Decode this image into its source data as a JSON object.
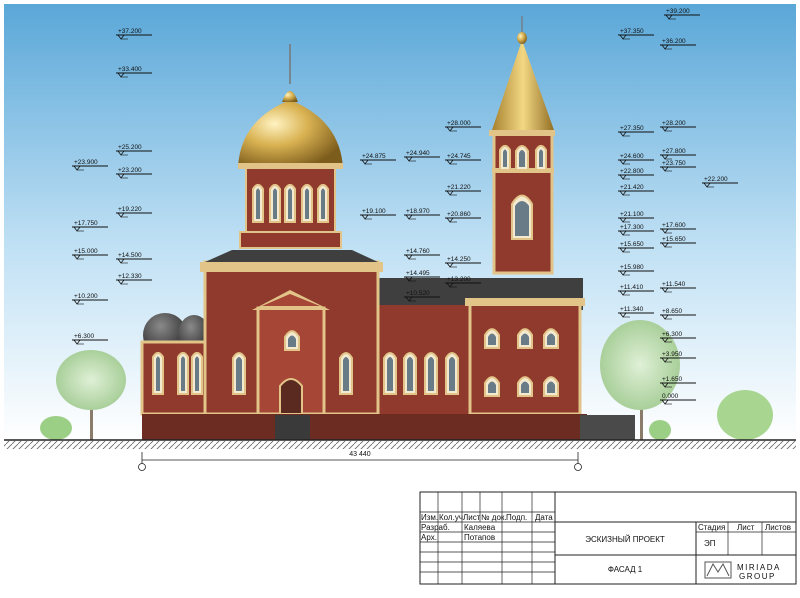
{
  "drawing": {
    "elevation_marks": [
      {
        "label": "+39.200",
        "side": "right"
      },
      {
        "label": "+37.200",
        "side": "left"
      },
      {
        "label": "+37.350",
        "side": "right"
      },
      {
        "label": "+36.200",
        "side": "right"
      },
      {
        "label": "+33.400",
        "side": "left"
      },
      {
        "label": "+28.000",
        "side": "mid"
      },
      {
        "label": "+27.350",
        "side": "right"
      },
      {
        "label": "+28.200",
        "side": "right"
      },
      {
        "label": "+27.800",
        "side": "right"
      },
      {
        "label": "+25.200",
        "side": "left"
      },
      {
        "label": "+24.875",
        "side": "mid"
      },
      {
        "label": "+24.940",
        "side": "mid"
      },
      {
        "label": "+24.745",
        "side": "mid"
      },
      {
        "label": "+24.600",
        "side": "right"
      },
      {
        "label": "+23.750",
        "side": "right"
      },
      {
        "label": "+23.900",
        "side": "left"
      },
      {
        "label": "+23.200",
        "side": "left"
      },
      {
        "label": "+22.800",
        "side": "right"
      },
      {
        "label": "+22.200",
        "side": "right"
      },
      {
        "label": "+21.420",
        "side": "right"
      },
      {
        "label": "+21.220",
        "side": "mid"
      },
      {
        "label": "+20.860",
        "side": "mid"
      },
      {
        "label": "+21.100",
        "side": "right"
      },
      {
        "label": "+19.220",
        "side": "left"
      },
      {
        "label": "+19.100",
        "side": "mid"
      },
      {
        "label": "+18.970",
        "side": "mid"
      },
      {
        "label": "+17.750",
        "side": "left"
      },
      {
        "label": "+17.300",
        "side": "right"
      },
      {
        "label": "+17.600",
        "side": "right"
      },
      {
        "label": "+15.650",
        "side": "right"
      },
      {
        "label": "+15.650",
        "side": "right"
      },
      {
        "label": "+15.000",
        "side": "left"
      },
      {
        "label": "+14.760",
        "side": "mid"
      },
      {
        "label": "+14.500",
        "side": "left"
      },
      {
        "label": "+14.250",
        "side": "mid"
      },
      {
        "label": "+14.495",
        "side": "mid"
      },
      {
        "label": "+15.980",
        "side": "right"
      },
      {
        "label": "+12.330",
        "side": "left"
      },
      {
        "label": "+13.200",
        "side": "mid"
      },
      {
        "label": "+11.410",
        "side": "right"
      },
      {
        "label": "+11.540",
        "side": "right"
      },
      {
        "label": "+10.200",
        "side": "left"
      },
      {
        "label": "+10.520",
        "side": "mid"
      },
      {
        "label": "+11.340",
        "side": "right"
      },
      {
        "label": "+8.650",
        "side": "right"
      },
      {
        "label": "+6.300",
        "side": "left"
      },
      {
        "label": "+6.300",
        "side": "right"
      },
      {
        "label": "+3.950",
        "side": "right"
      },
      {
        "label": "+1.650",
        "side": "right"
      },
      {
        "label": "0.000",
        "side": "right"
      }
    ],
    "overall_dimension": "43 440"
  },
  "title_block": {
    "headers": [
      "Изм.",
      "Кол.уч",
      "Лист",
      "№ док.",
      "Подп.",
      "Дата"
    ],
    "rows": [
      {
        "role": "Разраб.",
        "name": "Каляева"
      },
      {
        "role": "Арх.",
        "name": "Потапов"
      }
    ],
    "project_title": "ЭСКИЗНЫЙ ПРОЕКТ",
    "sheet_title": "ФАСАД 1",
    "col_labels": [
      "Стадия",
      "Лист",
      "Листов"
    ],
    "stage": "ЭП",
    "brand_name": "MIRIADA",
    "brand_sub": "GROUP"
  },
  "colors": {
    "sky_top": "#5aa7d8",
    "brick": "#8f3a2c",
    "trim": "#e2c388",
    "gold": "#d6b04a"
  }
}
